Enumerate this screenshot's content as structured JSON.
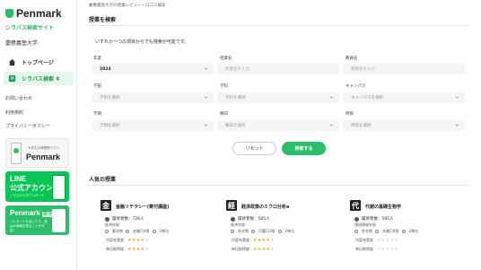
{
  "brand": {
    "name": "Penmark",
    "subtitle": "シラバス検索サイト",
    "university": "慶應義塾大学"
  },
  "nav": [
    {
      "label": "トップページ",
      "icon": "home-icon"
    },
    {
      "label": "シラバス検索",
      "icon": "book-icon",
      "ext": "⧉"
    }
  ],
  "side_links": [
    "お問い合わせ",
    "利用規約",
    "プライバシーポリシー"
  ],
  "banners": {
    "app": {
      "small": "大学生の時間割アプリ",
      "brand": "Penmark"
    },
    "line": {
      "line1": "LINE",
      "line2": "公式アカウント",
      "line3": "こちらからダウンロード"
    },
    "job": {
      "title": "Penmark",
      "tag": "就活",
      "desc": "インターンを探したり、就活の情報を見ることが可能！"
    }
  },
  "breadcrumb": "慶應義塾大学の授業レビュー・口コミ検索",
  "search_section": {
    "title": "授業を検索",
    "note": "いずれか一つの項目からでも検索が可能です。",
    "fields": {
      "year": {
        "label": "年度",
        "value": "2024"
      },
      "course_name": {
        "label": "授業名",
        "placeholder": "授業名を入力"
      },
      "teacher": {
        "label": "教員名",
        "placeholder": "教員名を入力"
      },
      "faculty": {
        "label": "学部",
        "placeholder": "学部を選択"
      },
      "department": {
        "label": "学科",
        "placeholder": "学科を選択"
      },
      "campus": {
        "label": "キャンパス",
        "placeholder": "キャンパスを選択"
      },
      "term": {
        "label": "学期",
        "placeholder": "学期を選択"
      },
      "day": {
        "label": "曜日",
        "placeholder": "曜日を選択"
      },
      "period": {
        "label": "時限",
        "placeholder": "時限を選択"
      }
    },
    "reset_label": "リセット",
    "search_label": "検索する"
  },
  "popular": {
    "title": "人気の授業",
    "rating_labels": {
      "satisfaction": "内容充実度",
      "credit": "単位取得度"
    },
    "cards": [
      {
        "kanji": "金",
        "title": "金融リテラシー(寄付講座)",
        "prof_label": "履修者数：",
        "prof": "726人",
        "dept": "経済学部",
        "term": "春学期",
        "day": "金曜日4限",
        "credits": "2単位",
        "satisfaction": 4,
        "credit": 4
      },
      {
        "kanji": "経",
        "title": "経済政策のミクロ分析a",
        "prof_label": "履修者数：",
        "prof": "585人",
        "dept": "経済学部",
        "term": "秋学期",
        "day": "月曜日3限",
        "credits": "2単位",
        "satisfaction": 4,
        "credit": 4
      },
      {
        "kanji": "代",
        "title": "代謝の基礎生物学",
        "prof_label": "履修者数：",
        "prof": "585人",
        "dept": "環境情報学部",
        "term": "秋学期",
        "day": "木曜日4限",
        "credits": "2単位",
        "satisfaction": 0,
        "credit": 0
      }
    ]
  },
  "colors": {
    "accent": "#2bbd6a",
    "line_green": "#06c755",
    "star": "#f5a623"
  }
}
